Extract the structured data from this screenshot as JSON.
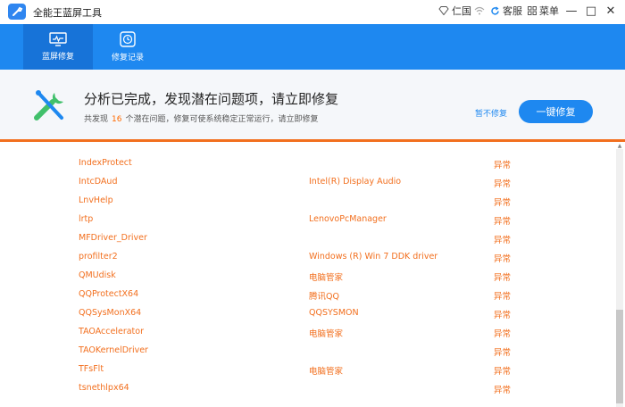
{
  "app": {
    "title": "全能王蓝屏工具",
    "user": "仁国",
    "service": "客服",
    "menu": "菜单",
    "win_min": "—",
    "win_max": "□",
    "win_close": "✕"
  },
  "nav": {
    "tabs": [
      {
        "label": "蓝屏修复",
        "icon": "monitor-icon"
      },
      {
        "label": "修复记录",
        "icon": "clock-icon"
      }
    ]
  },
  "summary": {
    "title": "分析已完成，发现潜在问题项，请立即修复",
    "sub_prefix": "共发现",
    "count": "16",
    "sub_suffix": "个潜在问题，修复可使系统稳定正常运行，请立即修复",
    "ignore": "暂不修复",
    "repair": "一键修复"
  },
  "colors": {
    "accent": "#1e88f0",
    "warning": "#f26f1e"
  },
  "rows": [
    {
      "name": "IndexProtect",
      "desc": "",
      "status": "异常"
    },
    {
      "name": "IntcDAud",
      "desc": "Intel(R) Display Audio",
      "status": "异常"
    },
    {
      "name": "LnvHelp",
      "desc": "",
      "status": "异常"
    },
    {
      "name": "lrtp",
      "desc": "LenovoPcManager",
      "status": "异常"
    },
    {
      "name": "MFDriver_Driver",
      "desc": "",
      "status": "异常"
    },
    {
      "name": "profilter2",
      "desc": "Windows (R) Win 7 DDK driver",
      "status": "异常"
    },
    {
      "name": "QMUdisk",
      "desc": "电脑管家",
      "status": "异常"
    },
    {
      "name": "QQProtectX64",
      "desc": "腾讯QQ",
      "status": "异常"
    },
    {
      "name": "QQSysMonX64",
      "desc": "QQSYSMON",
      "status": "异常"
    },
    {
      "name": "TAOAccelerator",
      "desc": "电脑管家",
      "status": "异常"
    },
    {
      "name": "TAOKernelDriver",
      "desc": "",
      "status": "异常"
    },
    {
      "name": "TFsFlt",
      "desc": "电脑管家",
      "status": "异常"
    },
    {
      "name": "tsnethlpx64",
      "desc": "",
      "status": "异常"
    }
  ]
}
